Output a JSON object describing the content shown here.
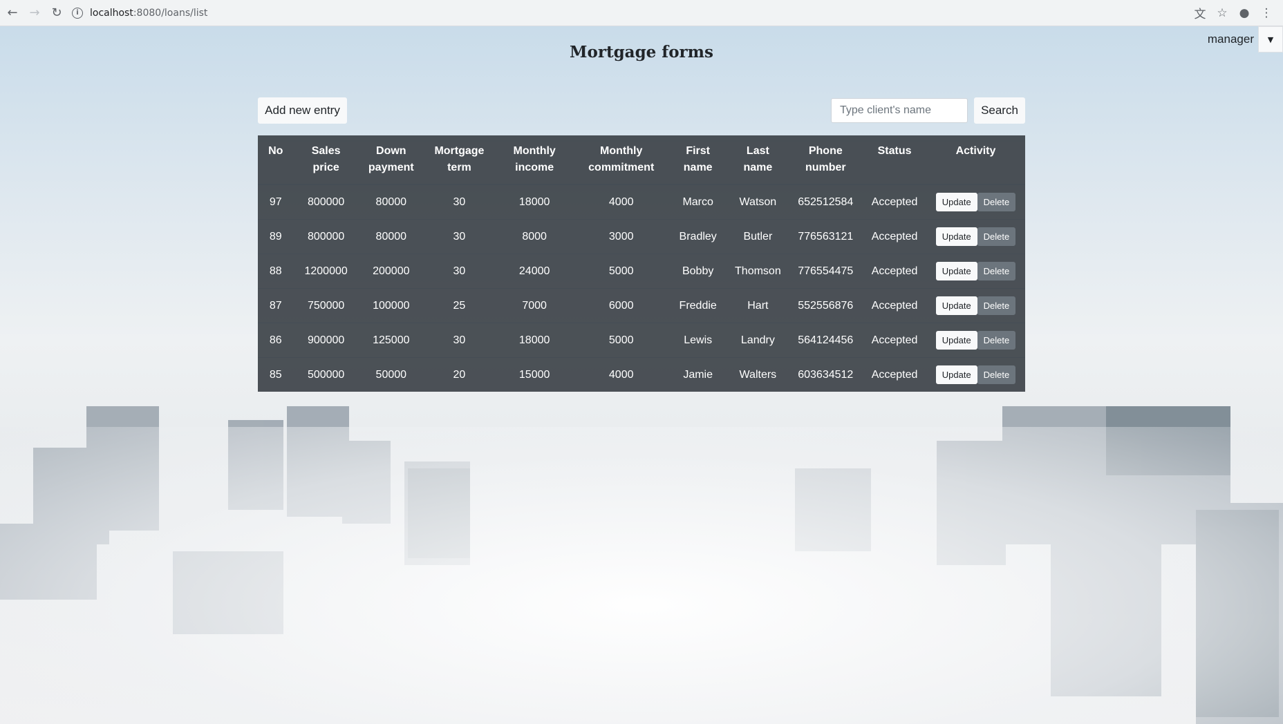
{
  "browser": {
    "url_host": "localhost",
    "url_port": ":8080",
    "url_path": "/loans/list"
  },
  "page": {
    "title": "Mortgage forms",
    "user": "manager"
  },
  "toolbar": {
    "add_label": "Add new entry",
    "search_placeholder": "Type client's name",
    "search_label": "Search"
  },
  "table": {
    "headers": [
      "No",
      "Sales price",
      "Down payment",
      "Mortgage term",
      "Monthly income",
      "Monthly commitment",
      "First name",
      "Last name",
      "Phone number",
      "Status",
      "Activity"
    ],
    "update_label": "Update",
    "delete_label": "Delete",
    "rows": [
      [
        "97",
        "800000",
        "80000",
        "30",
        "18000",
        "4000",
        "Marco",
        "Watson",
        "652512584",
        "Accepted"
      ],
      [
        "89",
        "800000",
        "80000",
        "30",
        "8000",
        "3000",
        "Bradley",
        "Butler",
        "776563121",
        "Accepted"
      ],
      [
        "88",
        "1200000",
        "200000",
        "30",
        "24000",
        "5000",
        "Bobby",
        "Thomson",
        "776554475",
        "Accepted"
      ],
      [
        "87",
        "750000",
        "100000",
        "25",
        "7000",
        "6000",
        "Freddie",
        "Hart",
        "552556876",
        "Accepted"
      ],
      [
        "86",
        "900000",
        "125000",
        "30",
        "18000",
        "5000",
        "Lewis",
        "Landry",
        "564124456",
        "Accepted"
      ],
      [
        "85",
        "500000",
        "50000",
        "20",
        "15000",
        "4000",
        "Jamie",
        "Walters",
        "603634512",
        "Accepted"
      ]
    ]
  },
  "icons": {
    "back": "arrow-left-icon",
    "forward": "arrow-right-icon",
    "reload": "reload-icon",
    "info": "info-icon",
    "translate": "translate-icon",
    "bookmark": "star-icon",
    "account": "account-icon",
    "menu": "kebab-menu-icon"
  }
}
